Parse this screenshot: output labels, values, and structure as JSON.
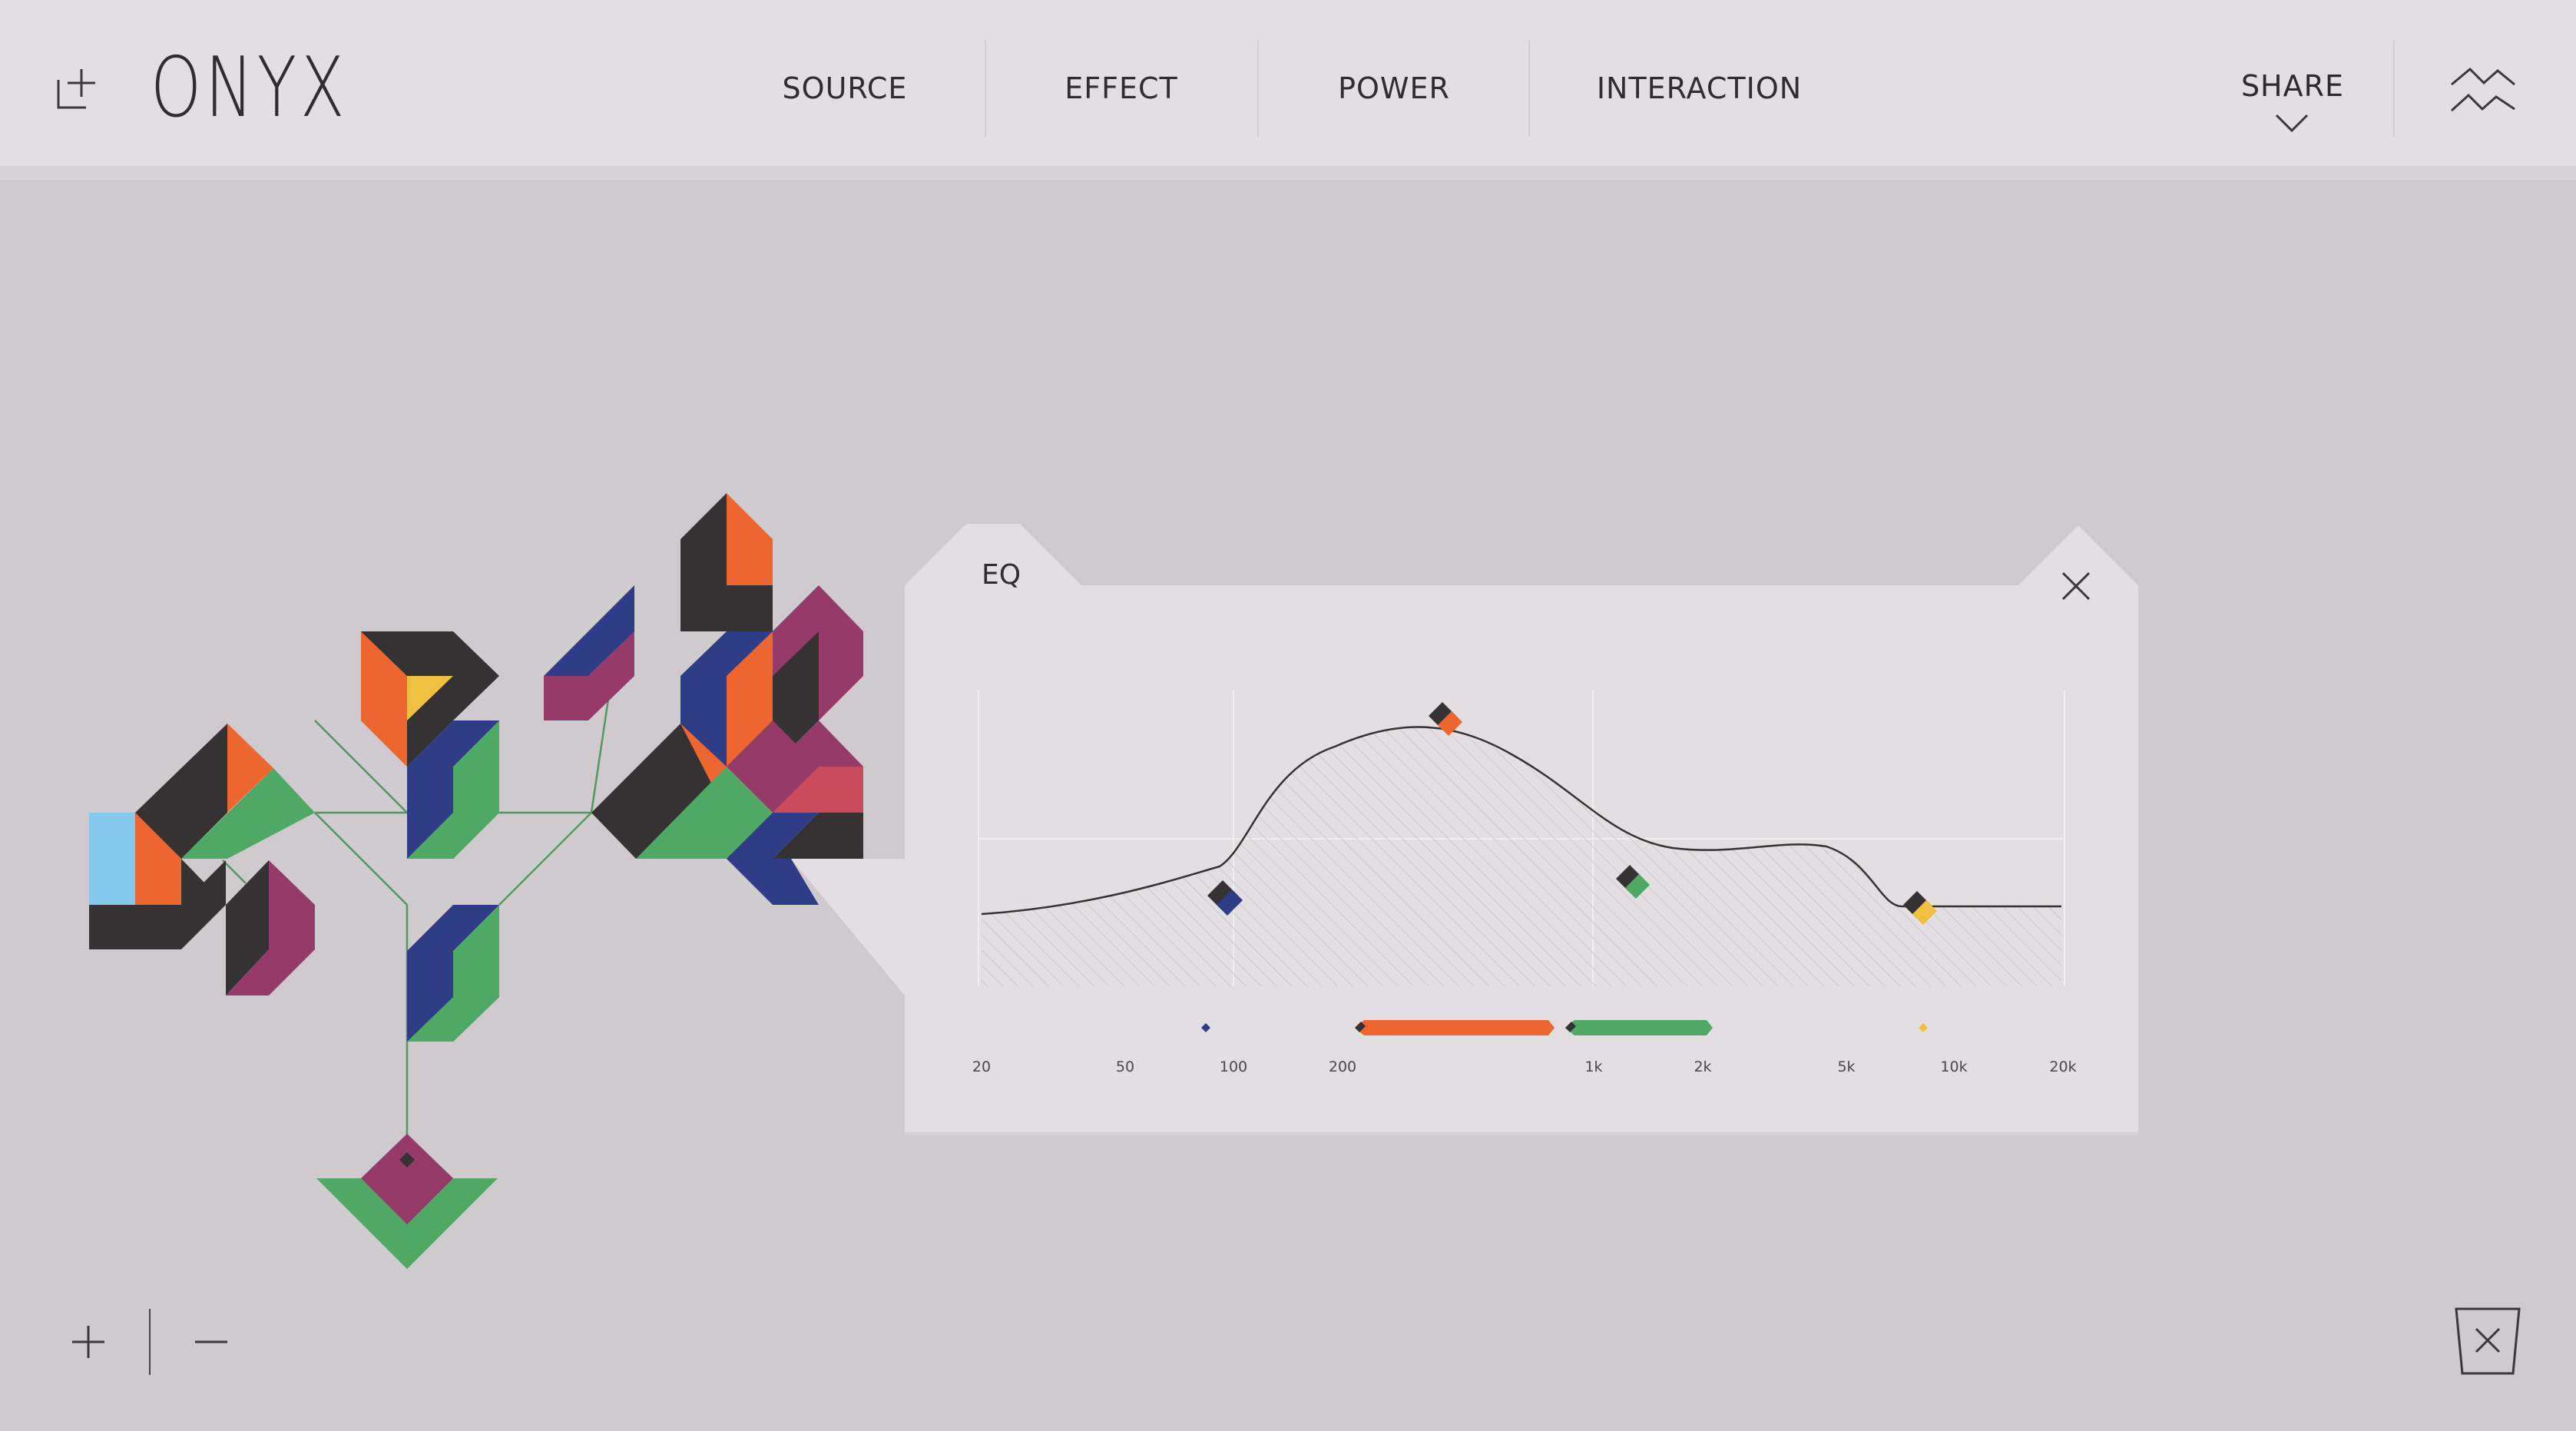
{
  "app": {
    "name": "ONYX"
  },
  "nav": {
    "items": [
      {
        "label": "SOURCE"
      },
      {
        "label": "EFFECT"
      },
      {
        "label": "POWER"
      },
      {
        "label": "INTERACTION"
      }
    ],
    "share_label": "SHARE"
  },
  "icons": {
    "add": "add-layer-icon",
    "share_chevron": "chevron-down-icon",
    "wave": "waveform-icon",
    "close": "close-icon",
    "zoom_in": "plus-icon",
    "zoom_out": "minus-icon",
    "trash": "trash-icon"
  },
  "eq": {
    "title": "EQ",
    "freq_labels": [
      "20",
      "50",
      "100",
      "200",
      "1k",
      "2k",
      "5k",
      "10k",
      "20k"
    ]
  },
  "colors": {
    "background": "#cfcacd",
    "bar": "#e2dee1",
    "panel": "#e2dee1",
    "dark": "#343232",
    "orange": "#ee662f",
    "blue": "#2f3c86",
    "green": "#4fa863",
    "purple": "#963a6a",
    "yellow": "#f1c040",
    "sky": "#86c9ee",
    "red": "#c94a5a",
    "line_green": "#4f9a63"
  }
}
